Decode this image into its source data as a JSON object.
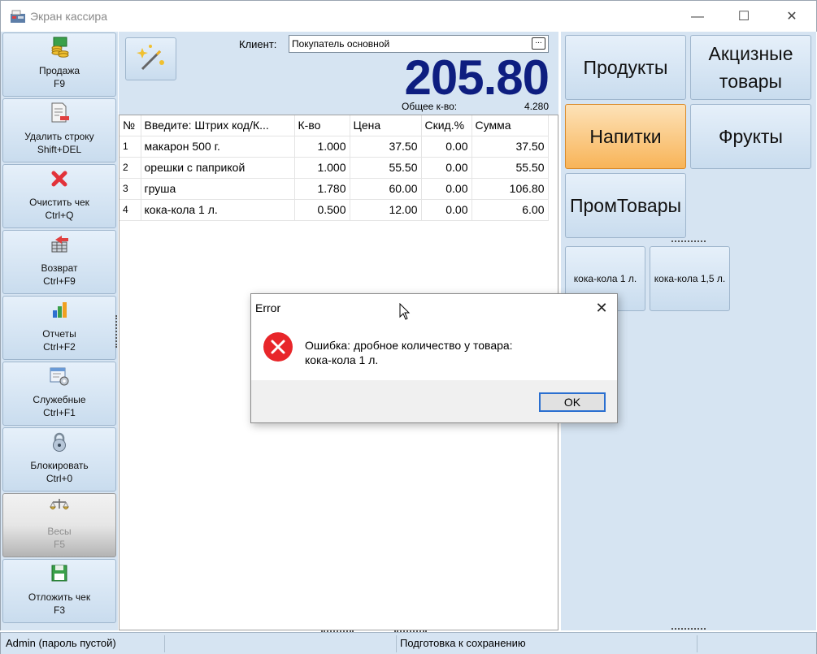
{
  "window": {
    "title": "Экран кассира",
    "minimize": "—",
    "maximize": "☐",
    "close": "✕"
  },
  "toolbar": {
    "items": [
      {
        "label": "Продажа\nF9",
        "icon": "coins-icon"
      },
      {
        "label": "Удалить строку\nShift+DEL",
        "icon": "delete-line-icon"
      },
      {
        "label": "Очистить чек\nCtrl+Q",
        "icon": "red-x-icon"
      },
      {
        "label": "Возврат\nCtrl+F9",
        "icon": "return-icon"
      },
      {
        "label": "Отчеты\nCtrl+F2",
        "icon": "bar-chart-icon"
      },
      {
        "label": "Служебные\nCtrl+F1",
        "icon": "service-settings-icon"
      },
      {
        "label": "Блокировать\nCtrl+0",
        "icon": "padlock-icon"
      },
      {
        "label": "Весы\nF5",
        "icon": "scales-icon",
        "disabled": true
      },
      {
        "label": "Отложить чек\nF3",
        "icon": "floppy-disk-icon"
      }
    ]
  },
  "receipt": {
    "client_label": "Клиент:",
    "client_value": "Покупатель основной",
    "client_dots": "...",
    "total": "205.80",
    "qty_label": "Общее к-во:",
    "qty_value": "4.280",
    "columns": [
      "№",
      "Введите: Штрих код/К...",
      "К-во",
      "Цена",
      "Скид.%",
      "Сумма"
    ],
    "rows": [
      [
        "1",
        "макарон 500 г.",
        "1.000",
        "37.50",
        "0.00",
        "37.50"
      ],
      [
        "2",
        "орешки с паприкой",
        "1.000",
        "55.50",
        "0.00",
        "55.50"
      ],
      [
        "3",
        "груша",
        "1.780",
        "60.00",
        "0.00",
        "106.80"
      ],
      [
        "4",
        "кока-кола 1 л.",
        "0.500",
        "12.00",
        "0.00",
        "6.00"
      ]
    ]
  },
  "categories": {
    "items": [
      {
        "label": "Продукты",
        "active": false
      },
      {
        "label": "Акцизные товары",
        "active": false
      },
      {
        "label": "Напитки",
        "active": true
      },
      {
        "label": "Фрукты",
        "active": false
      },
      {
        "label": "ПромТовары",
        "active": false
      }
    ],
    "products": [
      "кока-кола 1 л.",
      "кока-кола 1,5 л."
    ]
  },
  "status": {
    "user": "Admin (пароль пустой)",
    "message": "Подготовка к сохранению"
  },
  "dialog": {
    "title": "Error",
    "close": "✕",
    "message_line1": "Ошибка: дробное количество у товара:",
    "message_line2": "кока-кола 1 л.",
    "ok": "OK",
    "icon": "error-icon"
  },
  "colors": {
    "panel": "#d6e4f2",
    "total": "#0e1e80",
    "active_category": "#f8b458",
    "error_red": "#e8262a",
    "ok_focus": "#2a6fd0"
  }
}
